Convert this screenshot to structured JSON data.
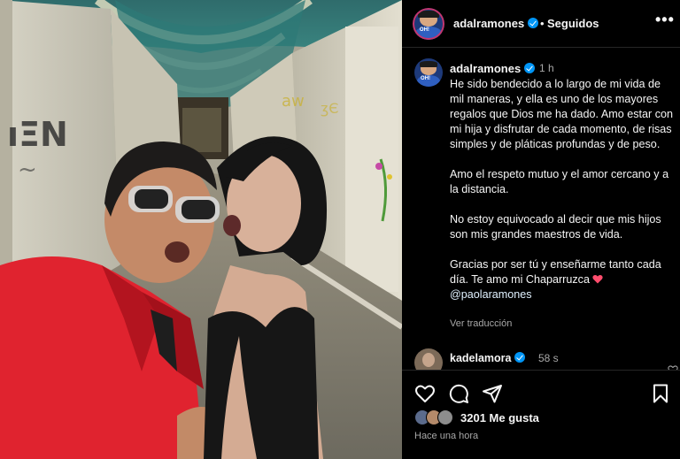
{
  "post": {
    "username": "adalramones",
    "separator": "•",
    "follow_status": "Seguidos",
    "caption_time": "1 h",
    "caption_paragraphs": [
      "He sido bendecido a lo largo de mi vida de mil maneras, y ella es uno de los mayores regalos que Dios me ha dado. Amo estar con mi hija y disfrutar de cada momento, de risas simples y de pláticas profundas y de peso.",
      "Amo el respeto mutuo y el amor cercano y a la distancia.",
      "No estoy equivocado al decir que mis hijos son mis grandes maestros de vida."
    ],
    "caption_last": "Gracias por ser tú y enseñarme tanto cada día. Te amo mi Chaparruzca",
    "mention": "@paolaramones",
    "translate_label": "Ver traducción",
    "avatar_tag": "OH!",
    "comment": {
      "username": "kadelamora",
      "time": "58 s",
      "hearts": "♥♥♥♥♥♥"
    },
    "likes": "3201 Me gusta",
    "time_ago": "Hace una hora"
  },
  "icons": {
    "more": "more-options-icon",
    "like": "heart-icon",
    "comment": "comment-bubble-icon",
    "share": "share-paper-plane-icon",
    "save": "bookmark-icon",
    "verified": "verified-badge-icon"
  },
  "colors": {
    "verified": "#0095f6",
    "background": "#000000",
    "secondary_text": "#a8a8a8",
    "heart": "#ed4956"
  }
}
